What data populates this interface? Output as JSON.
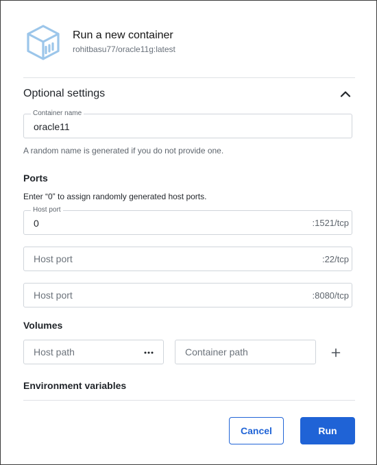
{
  "header": {
    "title": "Run a new container",
    "image_name": "rohitbasu77/oracle11g:latest",
    "icon": "container-icon"
  },
  "optional_settings": {
    "title": "Optional settings",
    "expanded": true,
    "container_name": {
      "label": "Container name",
      "value": "oracle11",
      "helper": "A random name is generated if you do not provide one."
    }
  },
  "ports": {
    "title": "Ports",
    "hint": "Enter “0” to assign randomly generated host ports.",
    "rows": [
      {
        "label": "Host port",
        "placeholder": "",
        "value": "0",
        "container_port": ":1521/tcp"
      },
      {
        "label": "",
        "placeholder": "Host port",
        "value": "",
        "container_port": ":22/tcp"
      },
      {
        "label": "",
        "placeholder": "Host port",
        "value": "",
        "container_port": ":8080/tcp"
      }
    ]
  },
  "volumes": {
    "title": "Volumes",
    "host_path_placeholder": "Host path",
    "container_path_placeholder": "Container path"
  },
  "env": {
    "title": "Environment variables"
  },
  "actions": {
    "cancel_label": "Cancel",
    "run_label": "Run"
  },
  "colors": {
    "accent": "#1f63d6",
    "icon": "#9cc6ea",
    "border": "#cfd4da"
  }
}
